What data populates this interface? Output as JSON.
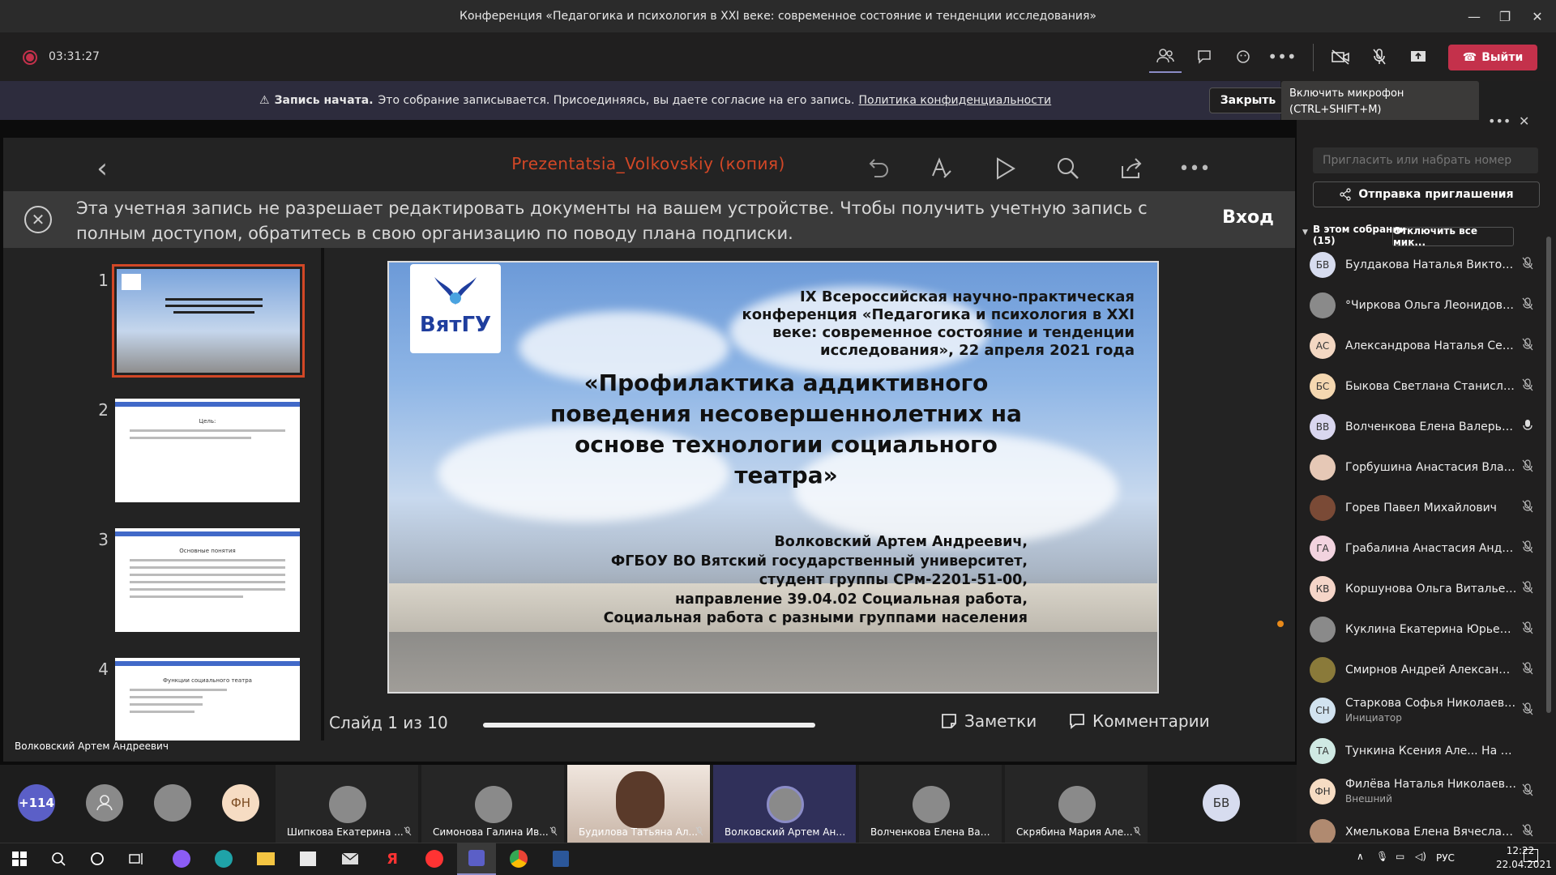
{
  "window": {
    "title": "Конференция «Педагогика и психология в XXI веке: современное состояние и тенденции исследования»"
  },
  "meeting": {
    "timer": "03:31:27",
    "leave_label": "Выйти"
  },
  "banner": {
    "title": "Запись начата.",
    "text": "Это собрание записывается. Присоединяясь, вы даете согласие на его запись.",
    "link": "Политика конфиденциальности",
    "close_label": "Закрыть"
  },
  "tooltip": {
    "line1": "Включить микрофон",
    "line2": "(CTRL+SHIFT+M)"
  },
  "presentation": {
    "file_title": "Prezentatsia_Volkovskiy (копия)",
    "notice": "Эта учетная запись не разрешает редактировать документы на вашем устройстве. Чтобы получить учетную запись с полным доступом, обратитесь в свою организацию по поводу плана подписки.",
    "login_label": "Вход",
    "slide_counter": "Слайд 1 из 10",
    "notes_label": "Заметки",
    "comments_label": "Комментарии",
    "thumbnails": [
      {
        "num": "1"
      },
      {
        "num": "2",
        "title": "Цель:"
      },
      {
        "num": "3",
        "title": "Основные понятия"
      },
      {
        "num": "4",
        "title": "Функции социального театра"
      }
    ],
    "slide": {
      "logo_text": "ВятГУ",
      "conference": "IX Всероссийская научно-практическая конференция «Педагогика и психология в XXI веке: современное состояние и тенденции исследования», 22 апреля 2021 года",
      "title": "«Профилактика аддиктивного поведения несовершеннолетних на основе технологии социального театра»",
      "author_lines": [
        "Волковский Артем Андреевич,",
        "ФГБОУ ВО Вятский государственный университет,",
        "студент группы СРм-2201-51-00,",
        "направление 39.04.02 Социальная работа,",
        "Социальная работа с разными группами населения"
      ]
    },
    "presenter_label": "Волковский Артем Андреевич"
  },
  "panel": {
    "invite_placeholder": "Пригласить или набрать номер",
    "send_invite_label": "Отправка приглашения",
    "in_meeting_label": "В этом собрании",
    "in_meeting_count": "(15)",
    "mute_all_label": "Отключить все мик...",
    "participants": [
      {
        "initials": "БВ",
        "name": "Булдакова Наталья Викторо...",
        "color": "#d7dcef",
        "mic": "off"
      },
      {
        "initials": "",
        "name": "°Чиркова Ольга Леонидовн...",
        "color": "#8a8a8a",
        "mic": "off"
      },
      {
        "initials": "АС",
        "name": "Александрова Наталья Серг...",
        "color": "#f3d7c2",
        "mic": "off"
      },
      {
        "initials": "БС",
        "name": "Быкова Светлана Станислав...",
        "color": "#f4d7b0",
        "mic": "off"
      },
      {
        "initials": "ВВ",
        "name": "Волченкова Елена Валерьев...",
        "color": "#d9d6ef",
        "mic": "on"
      },
      {
        "initials": "",
        "name": "Горбушина Анастасия Влади...",
        "color": "#e6c8b6",
        "mic": "off"
      },
      {
        "initials": "",
        "name": "Горев Павел Михайлович",
        "color": "#7a4a36",
        "mic": "off"
      },
      {
        "initials": "ГА",
        "name": "Грабалина Анастасия Андре...",
        "color": "#f2d3df",
        "mic": "off"
      },
      {
        "initials": "КВ",
        "name": "Коршунова Ольга Витальевна",
        "color": "#f5d5c8",
        "mic": "off"
      },
      {
        "initials": "",
        "name": "Куклина Екатерина Юрьевна",
        "color": "#8a8a8a",
        "mic": "off"
      },
      {
        "initials": "",
        "name": "Смирнов Андрей Александр...",
        "color": "#8a7a3a",
        "mic": "off"
      },
      {
        "initials": "СН",
        "name": "Старкова Софья Николаевна",
        "sub": "Инициатор",
        "color": "#d1e2ef",
        "mic": "off"
      },
      {
        "initials": "ТА",
        "name": "Тункина Ксения Але... На удержании",
        "color": "#cfe9e3",
        "mic": "none"
      },
      {
        "initials": "ФН",
        "name": "Филёва Наталья Николаевна",
        "sub": "Внешний",
        "color": "#f6dcc3",
        "mic": "off"
      },
      {
        "initials": "",
        "name": "Хмелькова Елена Вячеславо...",
        "color": "#b08a70",
        "mic": "off"
      }
    ]
  },
  "strip": {
    "overflow": "+114",
    "fn_initials": "ФН",
    "bv_initials": "БВ",
    "tiles": [
      {
        "name": "Шипкова Екатерина ..."
      },
      {
        "name": "Симонова Галина Ив..."
      },
      {
        "name": "Будилова Татьяна Ал..."
      },
      {
        "name": "Волковский Артем Андре..."
      },
      {
        "name": "Волченкова Елена Валер..."
      },
      {
        "name": "Скрябина Мария Але..."
      }
    ]
  },
  "taskbar": {
    "lang": "РУС",
    "time": "12:22",
    "date": "22.04.2021"
  }
}
